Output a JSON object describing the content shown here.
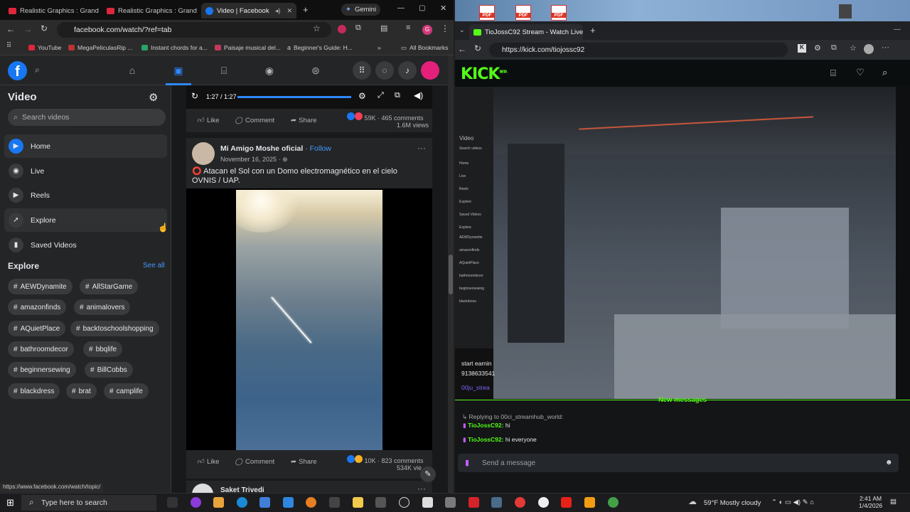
{
  "left_browser": {
    "tabs": [
      {
        "label": "Realistic Graphics : Grand",
        "icon": "youtube-icon"
      },
      {
        "label": "Realistic Graphics : Grand",
        "icon": "youtube-icon"
      },
      {
        "label": "Video | Facebook",
        "icon": "facebook-icon"
      }
    ],
    "gemini_label": "Gemini",
    "url": "facebook.com/watch/?ref=tab",
    "bookmarks": [
      "YouTube",
      "MegaPeliculasRip ...",
      "Instant chords for a...",
      "Paisaje musical del...",
      "Beginner's Guide: H..."
    ],
    "all_bookmarks": "All Bookmarks"
  },
  "fb": {
    "sidebar": {
      "title": "Video",
      "search_placeholder": "Search videos",
      "items": [
        {
          "label": "Home",
          "icon": "play-icon"
        },
        {
          "label": "Live",
          "icon": "live-icon"
        },
        {
          "label": "Reels",
          "icon": "reels-icon"
        },
        {
          "label": "Explore",
          "icon": "rocket-icon"
        },
        {
          "label": "Saved Videos",
          "icon": "bookmark-icon"
        }
      ],
      "explore_heading": "Explore",
      "see_all": "See all",
      "topics": [
        "AEWDynamite",
        "AllStarGame",
        "amazonfinds",
        "animalovers",
        "AQuietPlace",
        "backtoschoolshopping",
        "bathroomdecor",
        "bbqlife",
        "beginnersewing",
        "BillCobbs",
        "blackdress",
        "brat",
        "camplife"
      ]
    },
    "player": {
      "time": "1:27 / 1:27",
      "progress": 1.0
    },
    "post1_actions": {
      "like": "Like",
      "comment": "Comment",
      "share": "Share",
      "reactions": "59K",
      "comments": "465 comments",
      "views": "1.6M views"
    },
    "post2": {
      "author": "Mi Amigo Moshe oficial",
      "follow": "Follow",
      "date": "November 16, 2025",
      "caption": "Atacan el Sol con un Domo electromagnético en el cielo OVNIS / UAP.",
      "like": "Like",
      "comment": "Comment",
      "share": "Share",
      "reactions": "10K",
      "comments": "823 comments",
      "views": "534K vie"
    },
    "post3_author": "Saket Trivedi",
    "status_url": "https://www.facebook.com/watch/topic/"
  },
  "right_browser": {
    "tab_label": "TioJossC92 Stream - Watch Live o",
    "url": "https://kick.com/tiojossc92",
    "logo": "KICK",
    "logo_sup": "BETA",
    "chat_fragments": [
      "start earnin",
      "9138633541",
      "00ju_strea"
    ],
    "new_messages": "New messages",
    "reply_to": "Replying to 00ci_streamhub_world:",
    "messages": [
      {
        "user": "TioJossC92:",
        "text": "hi"
      },
      {
        "user": "TioJossC92:",
        "text": "hi everyone"
      }
    ],
    "send_placeholder": "Send a message",
    "mini_ui": [
      "Video",
      "Search videos",
      "Home",
      "Live",
      "Reels",
      "Explore",
      "Saved Videos",
      "Explore",
      "AEWDynamite",
      "amazonfinds",
      "AQuietPlace",
      "bathroomdecor",
      "beginnersewing",
      "blackdress"
    ]
  },
  "taskbar": {
    "search_placeholder": "Type here to search",
    "weather": "59°F  Mostly cloudy",
    "time": "2:41 AM",
    "date": "1/4/2026"
  }
}
